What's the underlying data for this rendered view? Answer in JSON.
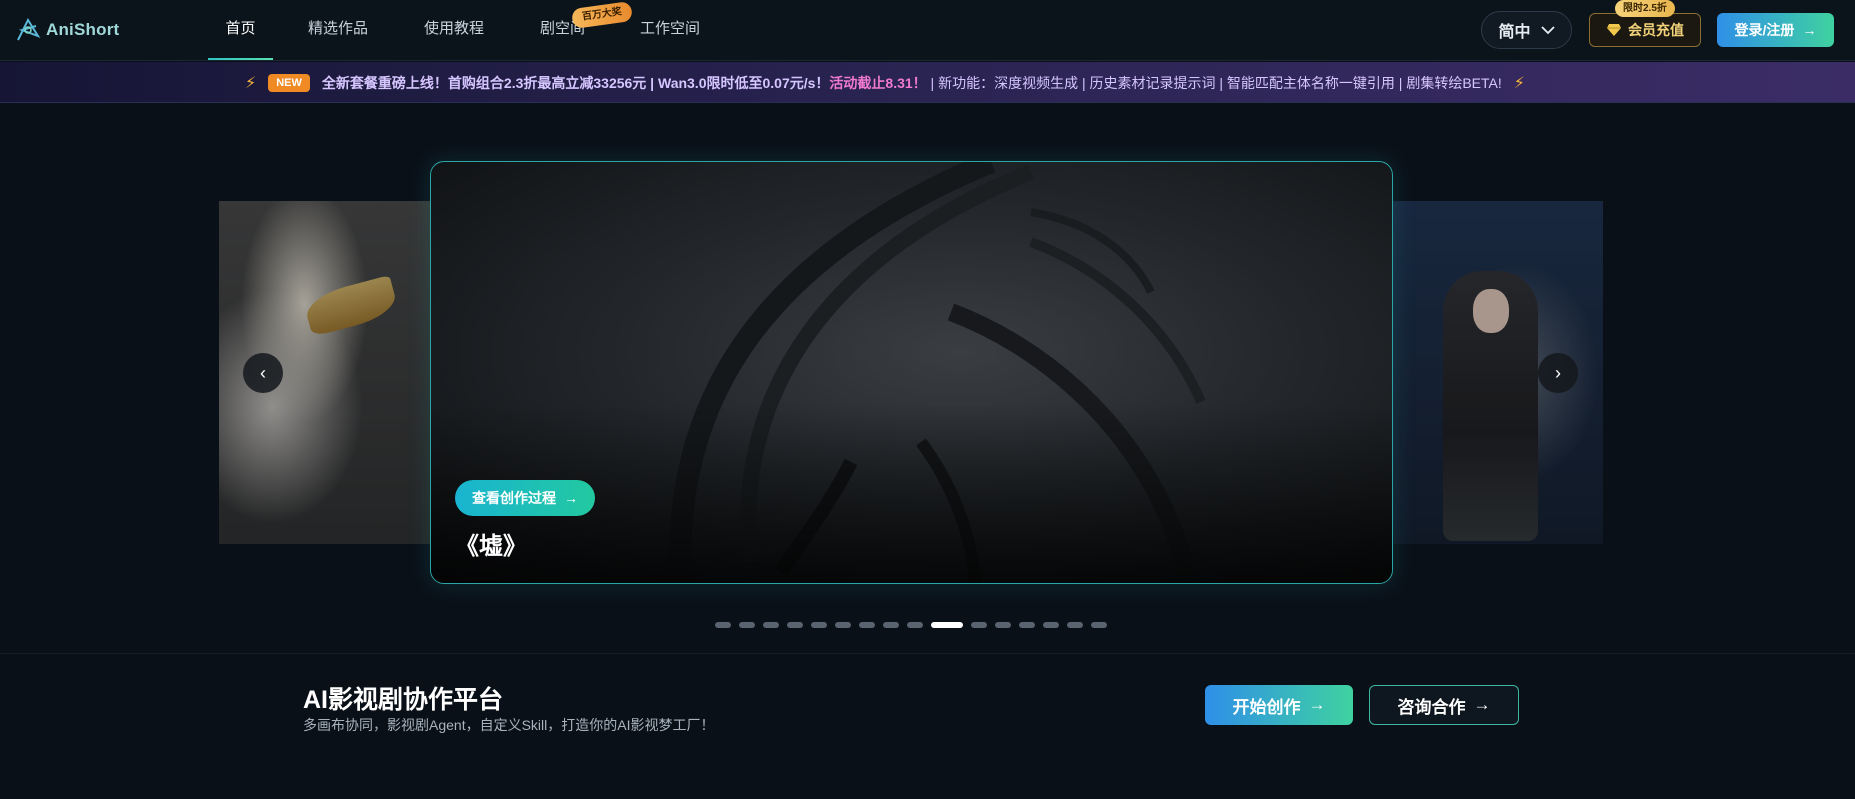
{
  "header": {
    "logo_text": "AniShort",
    "nav": [
      {
        "label": "首页",
        "active": true
      },
      {
        "label": "精选作品"
      },
      {
        "label": "使用教程"
      },
      {
        "label": "剧空间"
      },
      {
        "label": "工作空间"
      }
    ],
    "nav_badge": "百万大奖",
    "lang_label": "简中",
    "vip_label": "会员充值",
    "vip_badge": "限时2.5折",
    "login_label": "登录/注册"
  },
  "announcement": {
    "tag": "NEW",
    "part1": "全新套餐重磅上线！首购组合2.3折最高立减33256元 | Wan3.0限时低至0.07元/s！",
    "part2": "活动截止8.31！",
    "part3": " | 新功能：深度视频生成 | 历史素材记录提示词 | 智能匹配主体名称一键引用 | 剧集转绘BETA!"
  },
  "carousel": {
    "view_button": "查看创作过程",
    "title": "《墟》",
    "dot_count": 16,
    "active_index": 9
  },
  "cta": {
    "title": "AI影视剧协作平台",
    "subtitle": "多画布协同，影视剧Agent，自定义Skill，打造你的AI影视梦工厂！",
    "start_button": "开始创作",
    "consult_button": "咨询合作"
  },
  "colors": {
    "accent_start": "#2f8fe8",
    "accent_end": "#3fd2a0",
    "background": "#0a1018"
  }
}
